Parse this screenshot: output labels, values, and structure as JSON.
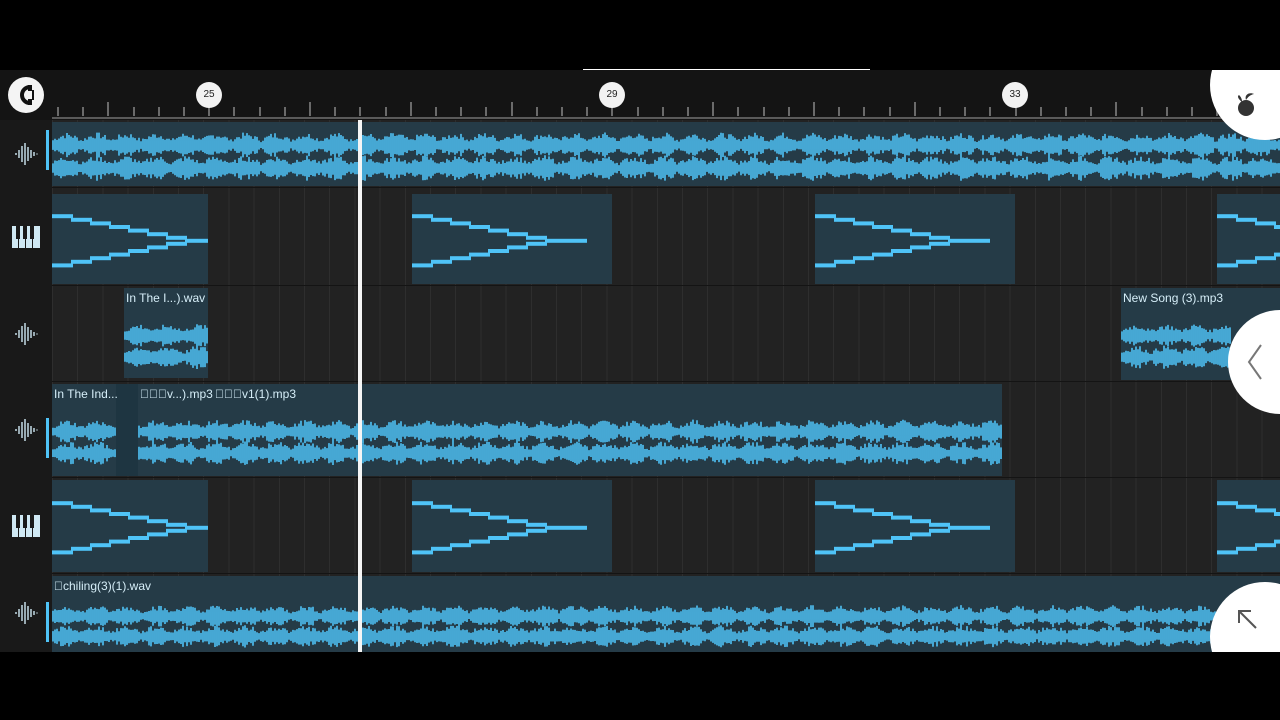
{
  "ruler": {
    "markers": [
      {
        "label": "25",
        "bar": 25
      },
      {
        "label": "29",
        "bar": 29
      },
      {
        "label": "33",
        "bar": 33
      }
    ]
  },
  "tracks": [
    {
      "type": "audio",
      "icon": "waveform-icon",
      "selected": true
    },
    {
      "type": "pattern",
      "icon": "piano-keys-icon",
      "selected": false
    },
    {
      "type": "audio",
      "icon": "waveform-icon",
      "selected": false
    },
    {
      "type": "audio",
      "icon": "waveform-icon",
      "selected": true
    },
    {
      "type": "pattern",
      "icon": "piano-keys-icon",
      "selected": false
    },
    {
      "type": "audio",
      "icon": "waveform-icon",
      "selected": true
    }
  ],
  "clips": {
    "in_the_i_wav": "In The I...).wav",
    "new_song_mp3": "New Song (3).mp3",
    "in_the_ind": "In The Ind...",
    "v_mp3": "\u0000\u0000\u0000v...).mp3",
    "v1_mp3": "\u0000\u0000\u0000v1(1).mp3",
    "chiling_wav": "\u0000chiling(3)(1).wav"
  },
  "colors": {
    "accent": "#4fc3f7",
    "background": "#1f1f1f",
    "clip": "#253b47",
    "playhead": "#f5f5f5"
  }
}
